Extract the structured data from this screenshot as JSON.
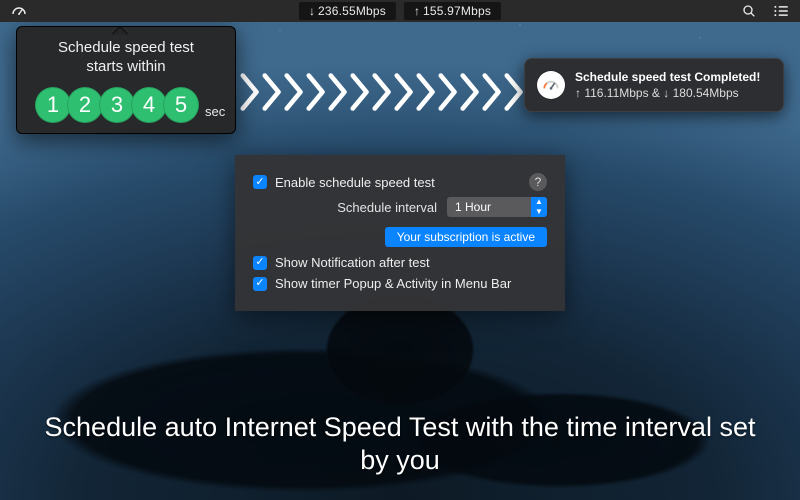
{
  "menubar": {
    "download_speed": "236.55Mbps",
    "upload_speed": "155.97Mbps"
  },
  "popover": {
    "title_line1": "Schedule speed test",
    "title_line2": "starts within",
    "digits": [
      "1",
      "2",
      "3",
      "4",
      "5"
    ],
    "sec_label": "sec"
  },
  "notification": {
    "title": "Schedule speed test Completed!",
    "subtitle": "↑ 116.11Mbps & ↓ 180.54Mbps"
  },
  "settings": {
    "enable_label": "Enable schedule speed test",
    "interval_label": "Schedule interval",
    "interval_value": "1 Hour",
    "subscription": "Your subscription is active",
    "notif_label": "Show Notification after test",
    "timer_label": "Show timer Popup & Activity in Menu Bar"
  },
  "caption": "Schedule auto Internet Speed Test with the time interval set by you",
  "colors": {
    "accent": "#0a84ff",
    "green": "#2fbf71"
  }
}
